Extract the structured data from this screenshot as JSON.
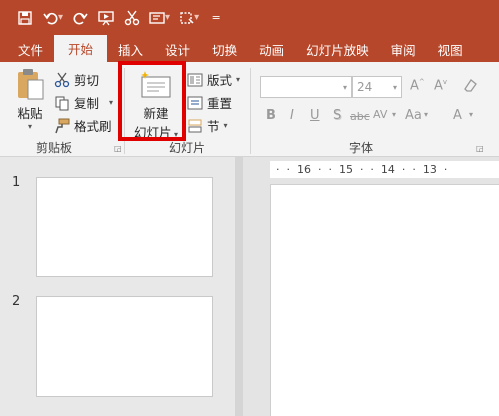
{
  "quick_access": {
    "icons": [
      "save-icon",
      "undo-icon",
      "redo-icon",
      "present-icon",
      "cut-icon",
      "textbox-icon",
      "screenshot-icon",
      "customize-icon"
    ]
  },
  "tabs": [
    "文件",
    "开始",
    "插入",
    "设计",
    "切换",
    "动画",
    "幻灯片放映",
    "审阅",
    "视图"
  ],
  "active_tab": "开始",
  "clipboard": {
    "paste": "粘贴",
    "cut": "剪切",
    "copy": "复制",
    "format_painter": "格式刷",
    "group": "剪贴板"
  },
  "slides_group": {
    "new_slide_line1": "新建",
    "new_slide_line2": "幻灯片",
    "layout": "版式",
    "reset": "重置",
    "section": "节",
    "group": "幻灯片"
  },
  "font_group": {
    "font_size": "24",
    "group": "字体",
    "buttons": [
      "B",
      "I",
      "U",
      "S",
      "abc",
      "AV",
      "Aa",
      "A"
    ]
  },
  "slide_pane": {
    "slide_numbers": [
      "1",
      "2"
    ]
  },
  "ruler": [
    "·  ·  16  ·  ·  15  ·  ·  14  ·  ·  13  ·"
  ],
  "colors": {
    "accent": "#b7472a",
    "highlight": "#e00000"
  }
}
